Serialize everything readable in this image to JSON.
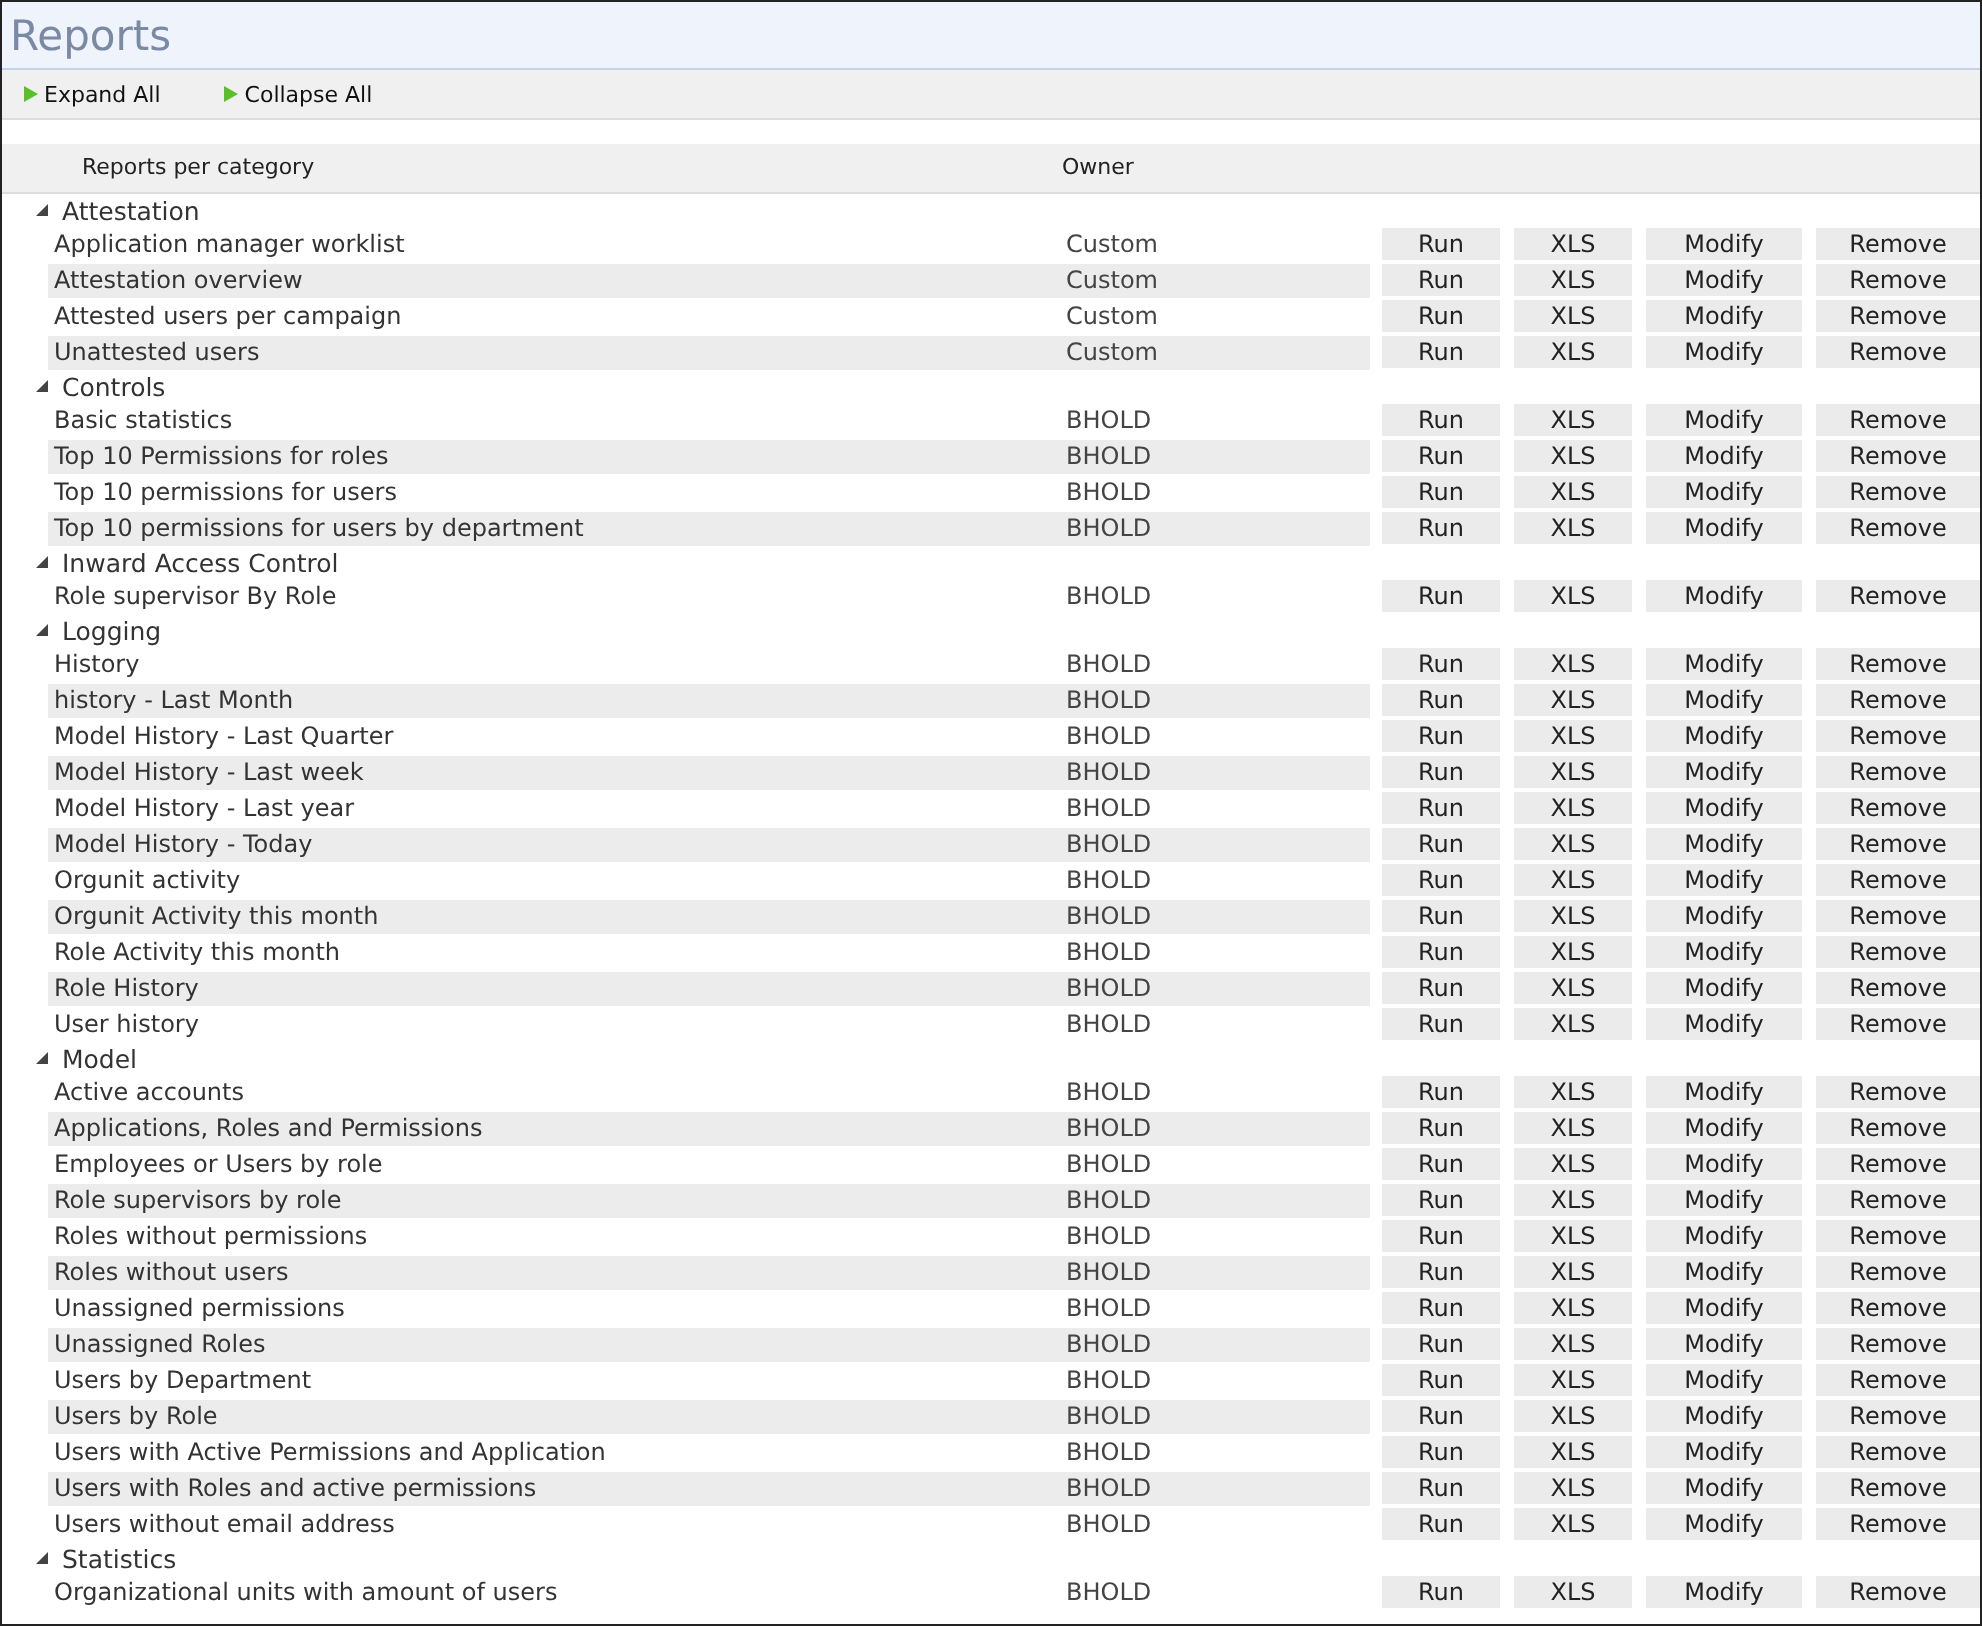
{
  "title": "Reports",
  "toolbar": [
    {
      "label": "Expand All"
    },
    {
      "label": "Collapse All"
    }
  ],
  "columns": [
    "Reports per category",
    "Owner"
  ],
  "categories": [
    {
      "name": "Attestation",
      "expanded": true,
      "reports": [
        {
          "name": "Application manager worklist",
          "owner": "Custom",
          "actions": [
            "Run",
            "XLS",
            "Modify",
            "Remove"
          ]
        },
        {
          "name": "Attestation overview",
          "owner": "Custom",
          "actions": [
            "Run",
            "XLS",
            "Modify",
            "Remove"
          ]
        },
        {
          "name": "Attested users per campaign",
          "owner": "Custom",
          "actions": [
            "Run",
            "XLS",
            "Modify",
            "Remove"
          ]
        },
        {
          "name": "Unattested users",
          "owner": "Custom",
          "actions": [
            "Run",
            "XLS",
            "Modify",
            "Remove"
          ]
        }
      ]
    },
    {
      "name": "Controls",
      "expanded": true,
      "reports": [
        {
          "name": "Basic statistics",
          "owner": "BHOLD",
          "actions": [
            "Run",
            "XLS",
            "Modify",
            "Remove"
          ]
        },
        {
          "name": "Top 10 Permissions for roles",
          "owner": "BHOLD",
          "actions": [
            "Run",
            "XLS",
            "Modify",
            "Remove"
          ]
        },
        {
          "name": "Top 10 permissions for users",
          "owner": "BHOLD",
          "actions": [
            "Run",
            "XLS",
            "Modify",
            "Remove"
          ]
        },
        {
          "name": "Top 10 permissions for users by department",
          "owner": "BHOLD",
          "actions": [
            "Run",
            "XLS",
            "Modify",
            "Remove"
          ]
        }
      ]
    },
    {
      "name": "Inward Access Control",
      "expanded": true,
      "reports": [
        {
          "name": "Role supervisor By Role",
          "owner": "BHOLD",
          "actions": [
            "Run",
            "XLS",
            "Modify",
            "Remove"
          ]
        }
      ]
    },
    {
      "name": "Logging",
      "expanded": true,
      "reports": [
        {
          "name": "History",
          "owner": "BHOLD",
          "actions": [
            "Run",
            "XLS",
            "Modify",
            "Remove"
          ]
        },
        {
          "name": "history - Last Month",
          "owner": "BHOLD",
          "actions": [
            "Run",
            "XLS",
            "Modify",
            "Remove"
          ]
        },
        {
          "name": "Model History - Last Quarter",
          "owner": "BHOLD",
          "actions": [
            "Run",
            "XLS",
            "Modify",
            "Remove"
          ]
        },
        {
          "name": "Model History - Last week",
          "owner": "BHOLD",
          "actions": [
            "Run",
            "XLS",
            "Modify",
            "Remove"
          ]
        },
        {
          "name": "Model History - Last year",
          "owner": "BHOLD",
          "actions": [
            "Run",
            "XLS",
            "Modify",
            "Remove"
          ]
        },
        {
          "name": "Model History - Today",
          "owner": "BHOLD",
          "actions": [
            "Run",
            "XLS",
            "Modify",
            "Remove"
          ]
        },
        {
          "name": "Orgunit activity",
          "owner": "BHOLD",
          "actions": [
            "Run",
            "XLS",
            "Modify",
            "Remove"
          ]
        },
        {
          "name": "Orgunit Activity this month",
          "owner": "BHOLD",
          "actions": [
            "Run",
            "XLS",
            "Modify",
            "Remove"
          ]
        },
        {
          "name": "Role Activity this month",
          "owner": "BHOLD",
          "actions": [
            "Run",
            "XLS",
            "Modify",
            "Remove"
          ]
        },
        {
          "name": "Role History",
          "owner": "BHOLD",
          "actions": [
            "Run",
            "XLS",
            "Modify",
            "Remove"
          ]
        },
        {
          "name": "User history",
          "owner": "BHOLD",
          "actions": [
            "Run",
            "XLS",
            "Modify",
            "Remove"
          ]
        }
      ]
    },
    {
      "name": "Model",
      "expanded": true,
      "reports": [
        {
          "name": "Active accounts",
          "owner": "BHOLD",
          "actions": [
            "Run",
            "XLS",
            "Modify",
            "Remove"
          ]
        },
        {
          "name": "Applications, Roles and Permissions",
          "owner": "BHOLD",
          "actions": [
            "Run",
            "XLS",
            "Modify",
            "Remove"
          ]
        },
        {
          "name": "Employees or Users by role",
          "owner": "BHOLD",
          "actions": [
            "Run",
            "XLS",
            "Modify",
            "Remove"
          ]
        },
        {
          "name": "Role supervisors by role",
          "owner": "BHOLD",
          "actions": [
            "Run",
            "XLS",
            "Modify",
            "Remove"
          ]
        },
        {
          "name": "Roles without permissions",
          "owner": "BHOLD",
          "actions": [
            "Run",
            "XLS",
            "Modify",
            "Remove"
          ]
        },
        {
          "name": "Roles without users",
          "owner": "BHOLD",
          "actions": [
            "Run",
            "XLS",
            "Modify",
            "Remove"
          ]
        },
        {
          "name": "Unassigned permissions",
          "owner": "BHOLD",
          "actions": [
            "Run",
            "XLS",
            "Modify",
            "Remove"
          ]
        },
        {
          "name": "Unassigned Roles",
          "owner": "BHOLD",
          "actions": [
            "Run",
            "XLS",
            "Modify",
            "Remove"
          ]
        },
        {
          "name": "Users by Department",
          "owner": "BHOLD",
          "actions": [
            "Run",
            "XLS",
            "Modify",
            "Remove"
          ]
        },
        {
          "name": "Users by Role",
          "owner": "BHOLD",
          "actions": [
            "Run",
            "XLS",
            "Modify",
            "Remove"
          ]
        },
        {
          "name": "Users with Active Permissions and Application",
          "owner": "BHOLD",
          "actions": [
            "Run",
            "XLS",
            "Modify",
            "Remove"
          ]
        },
        {
          "name": "Users with Roles and active permissions",
          "owner": "BHOLD",
          "actions": [
            "Run",
            "XLS",
            "Modify",
            "Remove"
          ]
        },
        {
          "name": "Users without email address",
          "owner": "BHOLD",
          "actions": [
            "Run",
            "XLS",
            "Modify",
            "Remove"
          ]
        }
      ]
    },
    {
      "name": "Statistics",
      "expanded": true,
      "reports": [
        {
          "name": "Organizational units with amount of users",
          "owner": "BHOLD",
          "actions": [
            "Run",
            "XLS",
            "Modify",
            "Remove"
          ]
        }
      ]
    }
  ]
}
